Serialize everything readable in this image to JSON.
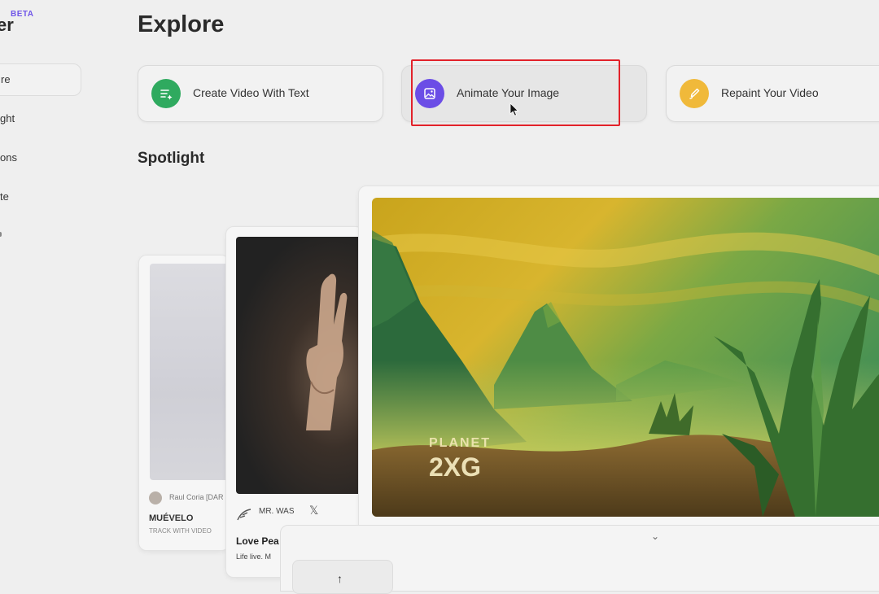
{
  "sidebar": {
    "logo_suffix": "er",
    "beta": "BETA",
    "items": [
      {
        "label": "re"
      },
      {
        "label": "ght"
      },
      {
        "label": "ons"
      },
      {
        "label": "te"
      }
    ]
  },
  "page_title": "Explore",
  "actions": [
    {
      "label": "Create Video With Text",
      "icon": "text-to-video-icon",
      "color": "#2faa5f"
    },
    {
      "label": "Animate Your Image",
      "icon": "image-icon",
      "color": "#6b4de6"
    },
    {
      "label": "Repaint Your Video",
      "icon": "brush-icon",
      "color": "#f0b93a"
    }
  ],
  "spotlight": {
    "title": "Spotlight",
    "cards": [
      {
        "author": "Raul Coria [DAR",
        "title": "MUÉVELO",
        "subtitle": "TRACK WITH VIDEO"
      },
      {
        "artist": "MR. WAS",
        "title": "Love Pea",
        "subtitle": "Life live. M"
      },
      {
        "art_text_line1": "PLANET",
        "art_text_line2": "2XG"
      }
    ]
  },
  "bottom_panel": {
    "chevron": "⌄",
    "upload_arrow": "↑"
  },
  "colors": {
    "highlight": "#e2222a",
    "beta": "#6f55e8"
  }
}
